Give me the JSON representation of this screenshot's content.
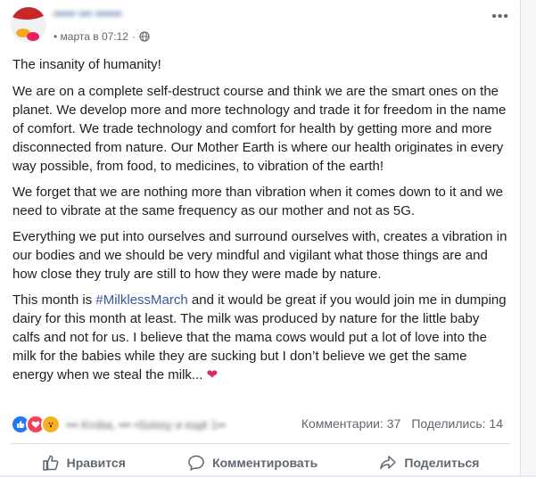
{
  "post": {
    "author": "••••• ••• ••••••",
    "date": "• марта в 07:12",
    "visibility_icon": "globe-icon",
    "title": "The insanity of humanity!",
    "paragraph1": "We are on a complete self-destruct course and think we are the smart ones on the planet. We develop more and more technology and trade it for freedom in the name of comfort. We trade technology and comfort for health by getting more and more disconnected from nature. Our Mother Earth is where our health originates in every way possible, from food, to medicines, to vibration of the earth!",
    "paragraph2": "We forget that we are nothing more than vibration when it comes down to it and we need to vibrate at the same frequency as our mother and not as 5G.",
    "paragraph3": "Everything we put into ourselves and surround ourselves with, creates a vibration in our bodies and we should be very mindful and vigilant what those things are and how close they truly are still to how they were made by nature.",
    "paragraph4_before": "This month is ",
    "hashtag": "#MilklessMarch",
    "paragraph4_after": " and it would be great if you would join me in dumping dairy for this month at least. The milk was produced by nature for the little baby calfs and not for us. I believe that the mama cows would put a lot of love into the milk for the babies while they are sucking but I don’t believe we get the same energy when we steal the milk... ",
    "heart": "❤"
  },
  "footer": {
    "reaction_names": "••• Kroba, ••• •Soissy и ещё 1••",
    "comments": "Комментарии: 37",
    "shares": "Поделились: 14"
  },
  "actions": {
    "like": "Нравится",
    "comment": "Комментировать",
    "share": "Поделиться"
  },
  "colors": {
    "link": "#385898",
    "like_reaction": "#2078f4",
    "love_reaction": "#f33e58",
    "heart": "#e0245e"
  }
}
